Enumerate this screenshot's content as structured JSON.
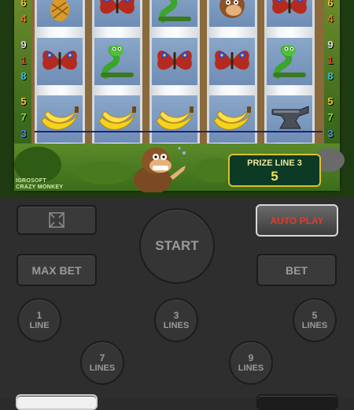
{
  "reels": [
    [
      "pineapple",
      "butterfly",
      "banana"
    ],
    [
      "butterfly",
      "snake",
      "banana"
    ],
    [
      "snake",
      "butterfly",
      "banana"
    ],
    [
      "monkey",
      "butterfly",
      "banana"
    ],
    [
      "butterfly",
      "snake",
      "anvil"
    ]
  ],
  "line_numbers_left": [
    "6",
    "4",
    "9",
    "1",
    "8",
    "5",
    "7",
    "3"
  ],
  "line_numbers_right": [
    "6",
    "4",
    "9",
    "1",
    "8",
    "5",
    "7",
    "3"
  ],
  "logo": {
    "line1": "IGROSOFT",
    "line2": "CRAZY MONKEY"
  },
  "prize": {
    "label": "PRIZE LINE 3",
    "value": "5"
  },
  "controls": {
    "fullscreen_label": "",
    "auto_play": "AUTO PLAY",
    "start": "START",
    "max_bet": "MAX BET",
    "bet": "BET",
    "lines": [
      {
        "n": "1",
        "label": "LINE"
      },
      {
        "n": "3",
        "label": "LINES"
      },
      {
        "n": "5",
        "label": "LINES"
      },
      {
        "n": "7",
        "label": "LINES"
      },
      {
        "n": "9",
        "label": "LINES"
      }
    ]
  },
  "colors": {
    "auto_play_text": "#e23b2a",
    "prize_border": "#d8c030",
    "win_line": "#1a237e"
  }
}
